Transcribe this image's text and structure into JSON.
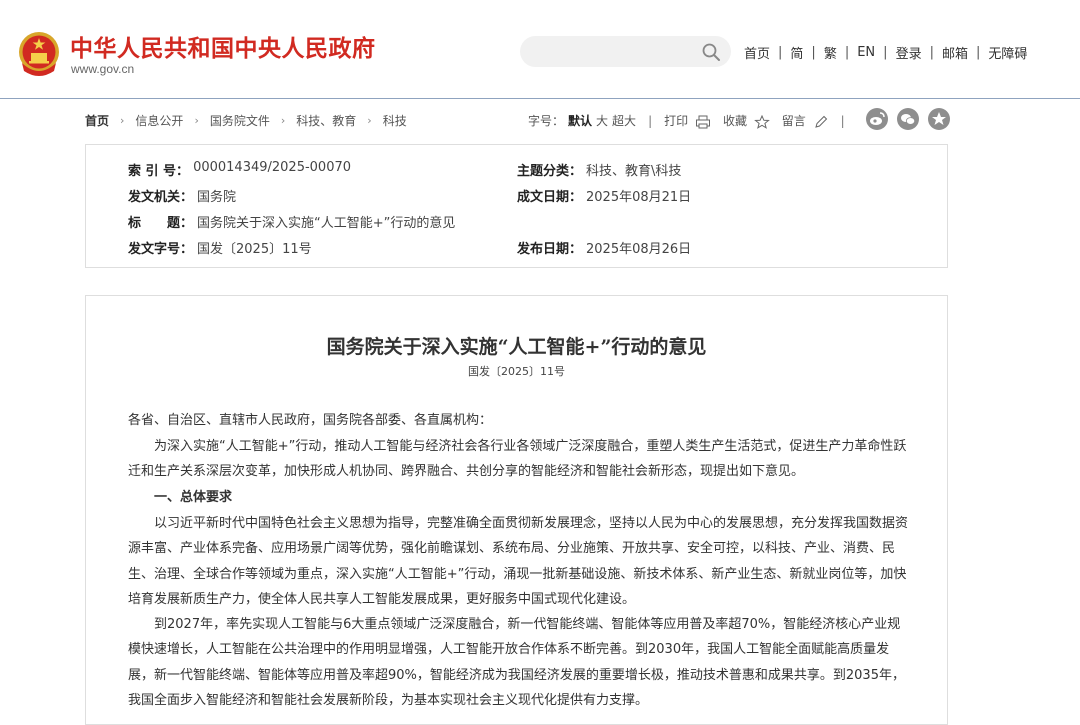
{
  "header": {
    "title": "中华人民共和国中央人民政府",
    "url": "www.gov.cn",
    "search_placeholder": "",
    "nav": [
      "首页",
      "简",
      "繁",
      "EN",
      "登录",
      "邮箱",
      "无障碍"
    ]
  },
  "breadcrumb": [
    "首页",
    "信息公开",
    "国务院文件",
    "科技、教育",
    "科技"
  ],
  "tools": {
    "font_size_label": "字号：",
    "font_default": "默认",
    "font_large": "大",
    "font_xlarge": "超大",
    "print": "打印",
    "favorite": "收藏",
    "comment": "留言"
  },
  "social_icons": [
    "weibo-icon",
    "wechat-icon",
    "star-app-icon"
  ],
  "meta": {
    "index_label": "索 引 号：",
    "index_value": "000014349/2025-00070",
    "topic_label": "主题分类：",
    "topic_value": "科技、教育\\科技",
    "issuer_label": "发文机关：",
    "issuer_value": "国务院",
    "date_written_label": "成文日期：",
    "date_written_value": "2025年08月21日",
    "title_label": "标　　题：",
    "title_value": "国务院关于深入实施“人工智能+”行动的意见",
    "docno_label": "发文字号：",
    "docno_value": "国发〔2025〕11号",
    "publish_label": "发布日期：",
    "publish_value": "2025年08月26日"
  },
  "article": {
    "title": "国务院关于深入实施“人工智能+”行动的意见",
    "doc_number": "国发〔2025〕11号",
    "salutation": "各省、自治区、直辖市人民政府，国务院各部委、各直属机构：",
    "intro": "为深入实施“人工智能+”行动，推动人工智能与经济社会各行业各领域广泛深度融合，重塑人类生产生活范式，促进生产力革命性跃迁和生产关系深层次变革，加快形成人机协同、跨界融合、共创分享的智能经济和智能社会新形态，现提出如下意见。",
    "section1_heading": "一、总体要求",
    "para1": "以习近平新时代中国特色社会主义思想为指导，完整准确全面贯彻新发展理念，坚持以人民为中心的发展思想，充分发挥我国数据资源丰富、产业体系完备、应用场景广阔等优势，强化前瞻谋划、系统布局、分业施策、开放共享、安全可控，以科技、产业、消费、民生、治理、全球合作等领域为重点，深入实施“人工智能+”行动，涌现一批新基础设施、新技术体系、新产业生态、新就业岗位等，加快培育发展新质生产力，使全体人民共享人工智能发展成果，更好服务中国式现代化建设。",
    "para2": "到2027年，率先实现人工智能与6大重点领域广泛深度融合，新一代智能终端、智能体等应用普及率超70%，智能经济核心产业规模快速增长，人工智能在公共治理中的作用明显增强，人工智能开放合作体系不断完善。到2030年，我国人工智能全面赋能高质量发展，新一代智能终端、智能体等应用普及率超90%，智能经济成为我国经济发展的重要增长极，推动技术普惠和成果共享。到2035年，我国全面步入智能经济和智能社会发展新阶段，为基本实现社会主义现代化提供有力支撑。"
  },
  "colors": {
    "brand_red": "#d12a21",
    "header_rule": "#8fa3bf",
    "border": "#dedede"
  }
}
